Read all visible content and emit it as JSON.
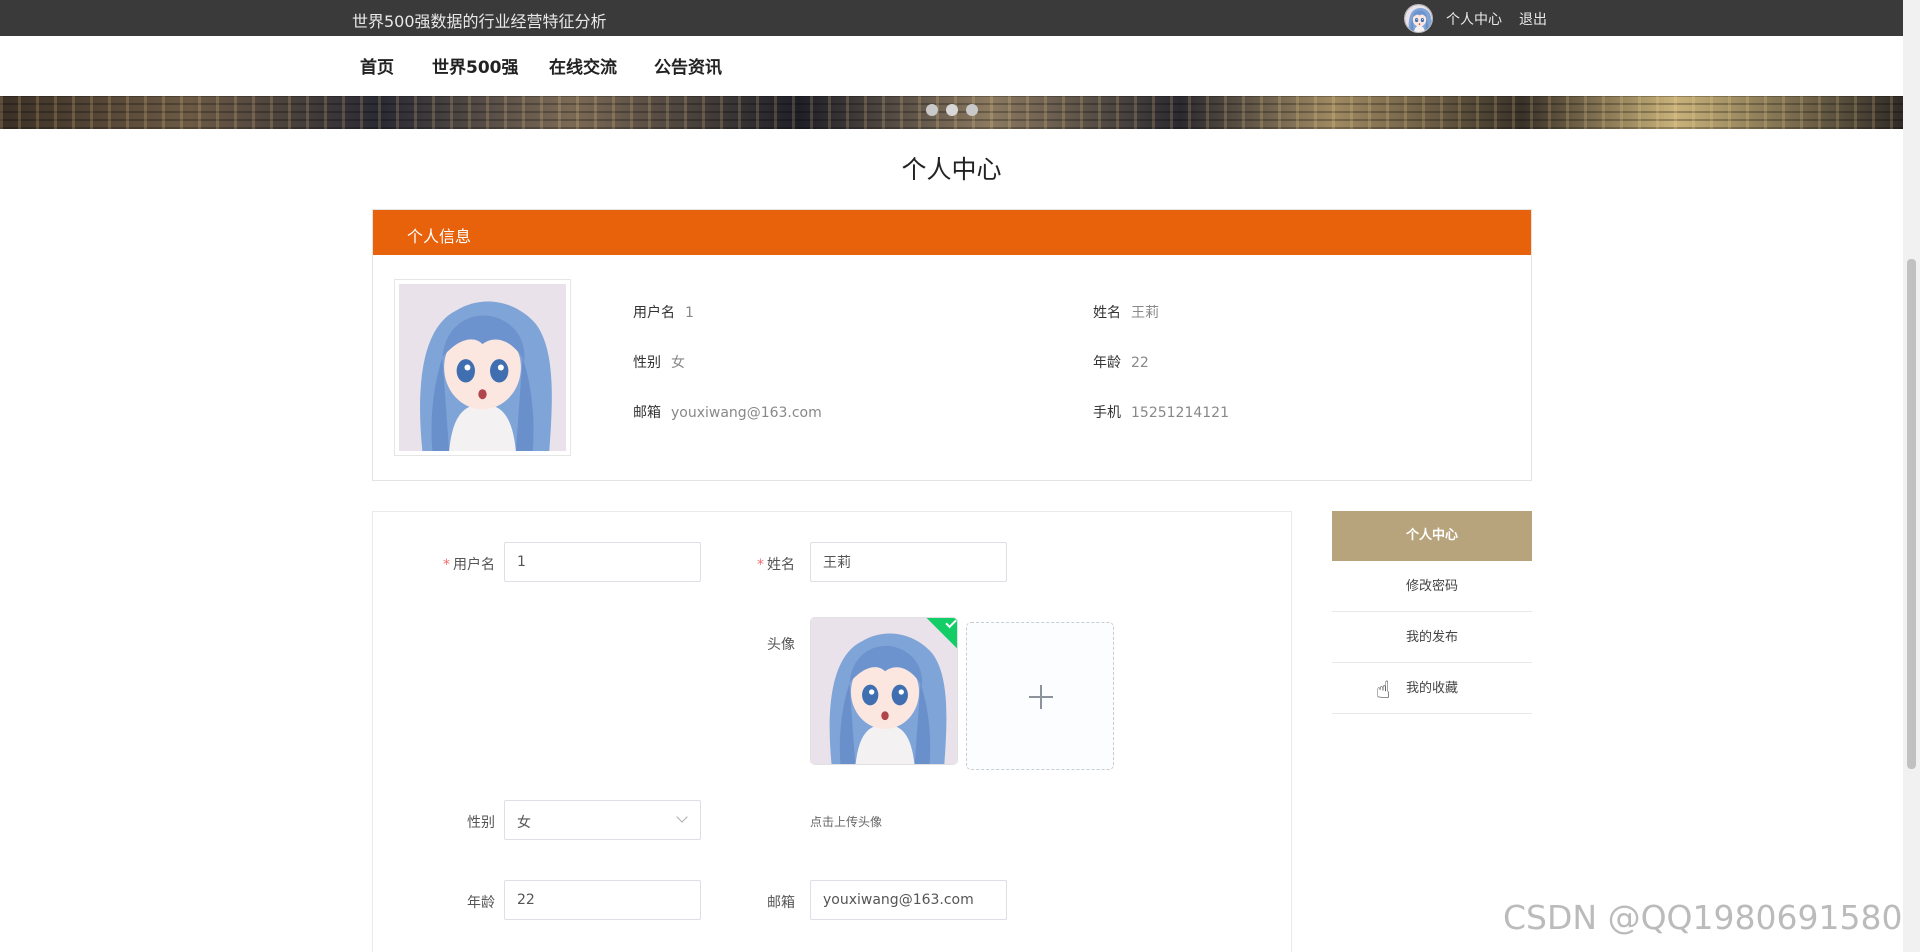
{
  "header": {
    "site_title": "世界500强数据的行业经营特征分析",
    "user_center": "个人中心",
    "logout": "退出"
  },
  "nav": {
    "items": [
      {
        "label": "首页"
      },
      {
        "label": "世界500强"
      },
      {
        "label": "在线交流"
      },
      {
        "label": "公告资讯"
      }
    ]
  },
  "banner": {
    "active_slide": 1,
    "slide_count": 3
  },
  "page": {
    "title": "个人中心"
  },
  "info": {
    "header": "个人信息",
    "username_label": "用户名",
    "username": "1",
    "name_label": "姓名",
    "name": "王莉",
    "gender_label": "性别",
    "gender": "女",
    "age_label": "年龄",
    "age": "22",
    "email_label": "邮箱",
    "email": "youxiwang@163.com",
    "phone_label": "手机",
    "phone": "15251214121"
  },
  "form": {
    "required_mark": "*",
    "username_label": "用户名",
    "username_value": "1",
    "name_label": "姓名",
    "name_value": "王莉",
    "avatar_label": "头像",
    "upload_hint": "点击上传头像",
    "gender_label": "性别",
    "gender_value": "女",
    "age_label": "年龄",
    "age_value": "22",
    "email_label": "邮箱",
    "email_value": "youxiwang@163.com"
  },
  "side_menu": {
    "items": [
      {
        "label": "个人中心",
        "active": true
      },
      {
        "label": "修改密码"
      },
      {
        "label": "我的发布"
      },
      {
        "label": "我的收藏"
      }
    ]
  },
  "watermark": "CSDN @QQ1980691580",
  "colors": {
    "topbar": "#3a3a3a",
    "accent_orange": "#e8620c",
    "side_active": "#b8a47c"
  }
}
